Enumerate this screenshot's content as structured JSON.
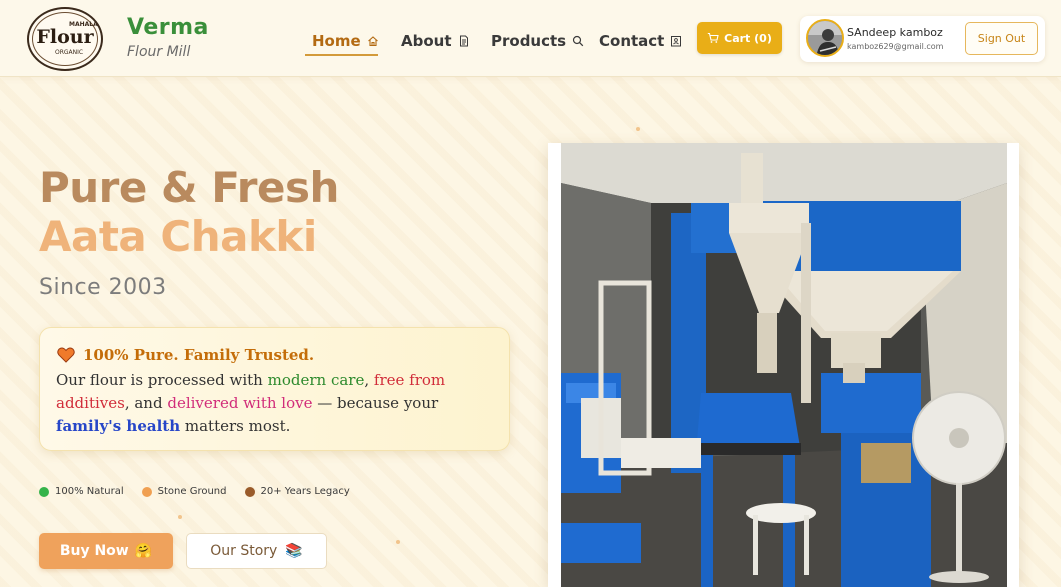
{
  "brand": {
    "logo_word": "Flour",
    "logo_top": "MAHALA",
    "logo_bottom": "ORGANIC",
    "name": "Verma",
    "subtitle": "Flour Mill"
  },
  "nav": {
    "items": [
      {
        "label": "Home",
        "icon": "home-icon",
        "active": true
      },
      {
        "label": "About",
        "icon": "document-icon",
        "active": false
      },
      {
        "label": "Products",
        "icon": "search-icon",
        "active": false
      },
      {
        "label": "Contact",
        "icon": "contact-card-icon",
        "active": false
      }
    ]
  },
  "cart": {
    "label": "Cart (0)",
    "icon": "cart-icon"
  },
  "user": {
    "name": "SAndeep kamboz",
    "email": "kamboz629@gmail.com",
    "signout_label": "Sign Out"
  },
  "hero": {
    "line1": "Pure & Fresh",
    "line2": "Aata Chakki",
    "since": "Since 2003"
  },
  "trust": {
    "heading": "100% Pure. Family Trusted.",
    "heading_icon": "heart-icon",
    "body": {
      "p1": "Our flour is processed with ",
      "p2": "modern care",
      "p3": ", ",
      "p4": "free from additives",
      "p5": ", and ",
      "p6": "delivered with love",
      "p7": " — because your ",
      "p8": "family's health",
      "p9": " matters most."
    }
  },
  "features": [
    {
      "label": "100% Natural",
      "color": "#35b34a"
    },
    {
      "label": "Stone Ground",
      "color": "#f0a052"
    },
    {
      "label": "20+ Years Legacy",
      "color": "#9a5b2a"
    }
  ],
  "buttons": {
    "buy_now": "Buy Now",
    "buy_now_emoji": "🤗",
    "our_story": "Our Story",
    "our_story_emoji": "📚"
  },
  "colors": {
    "accent_orange": "#efa25c",
    "cart_yellow": "#e9ae17",
    "brand_green": "#3a8f3a",
    "nav_active": "#b36a12"
  }
}
